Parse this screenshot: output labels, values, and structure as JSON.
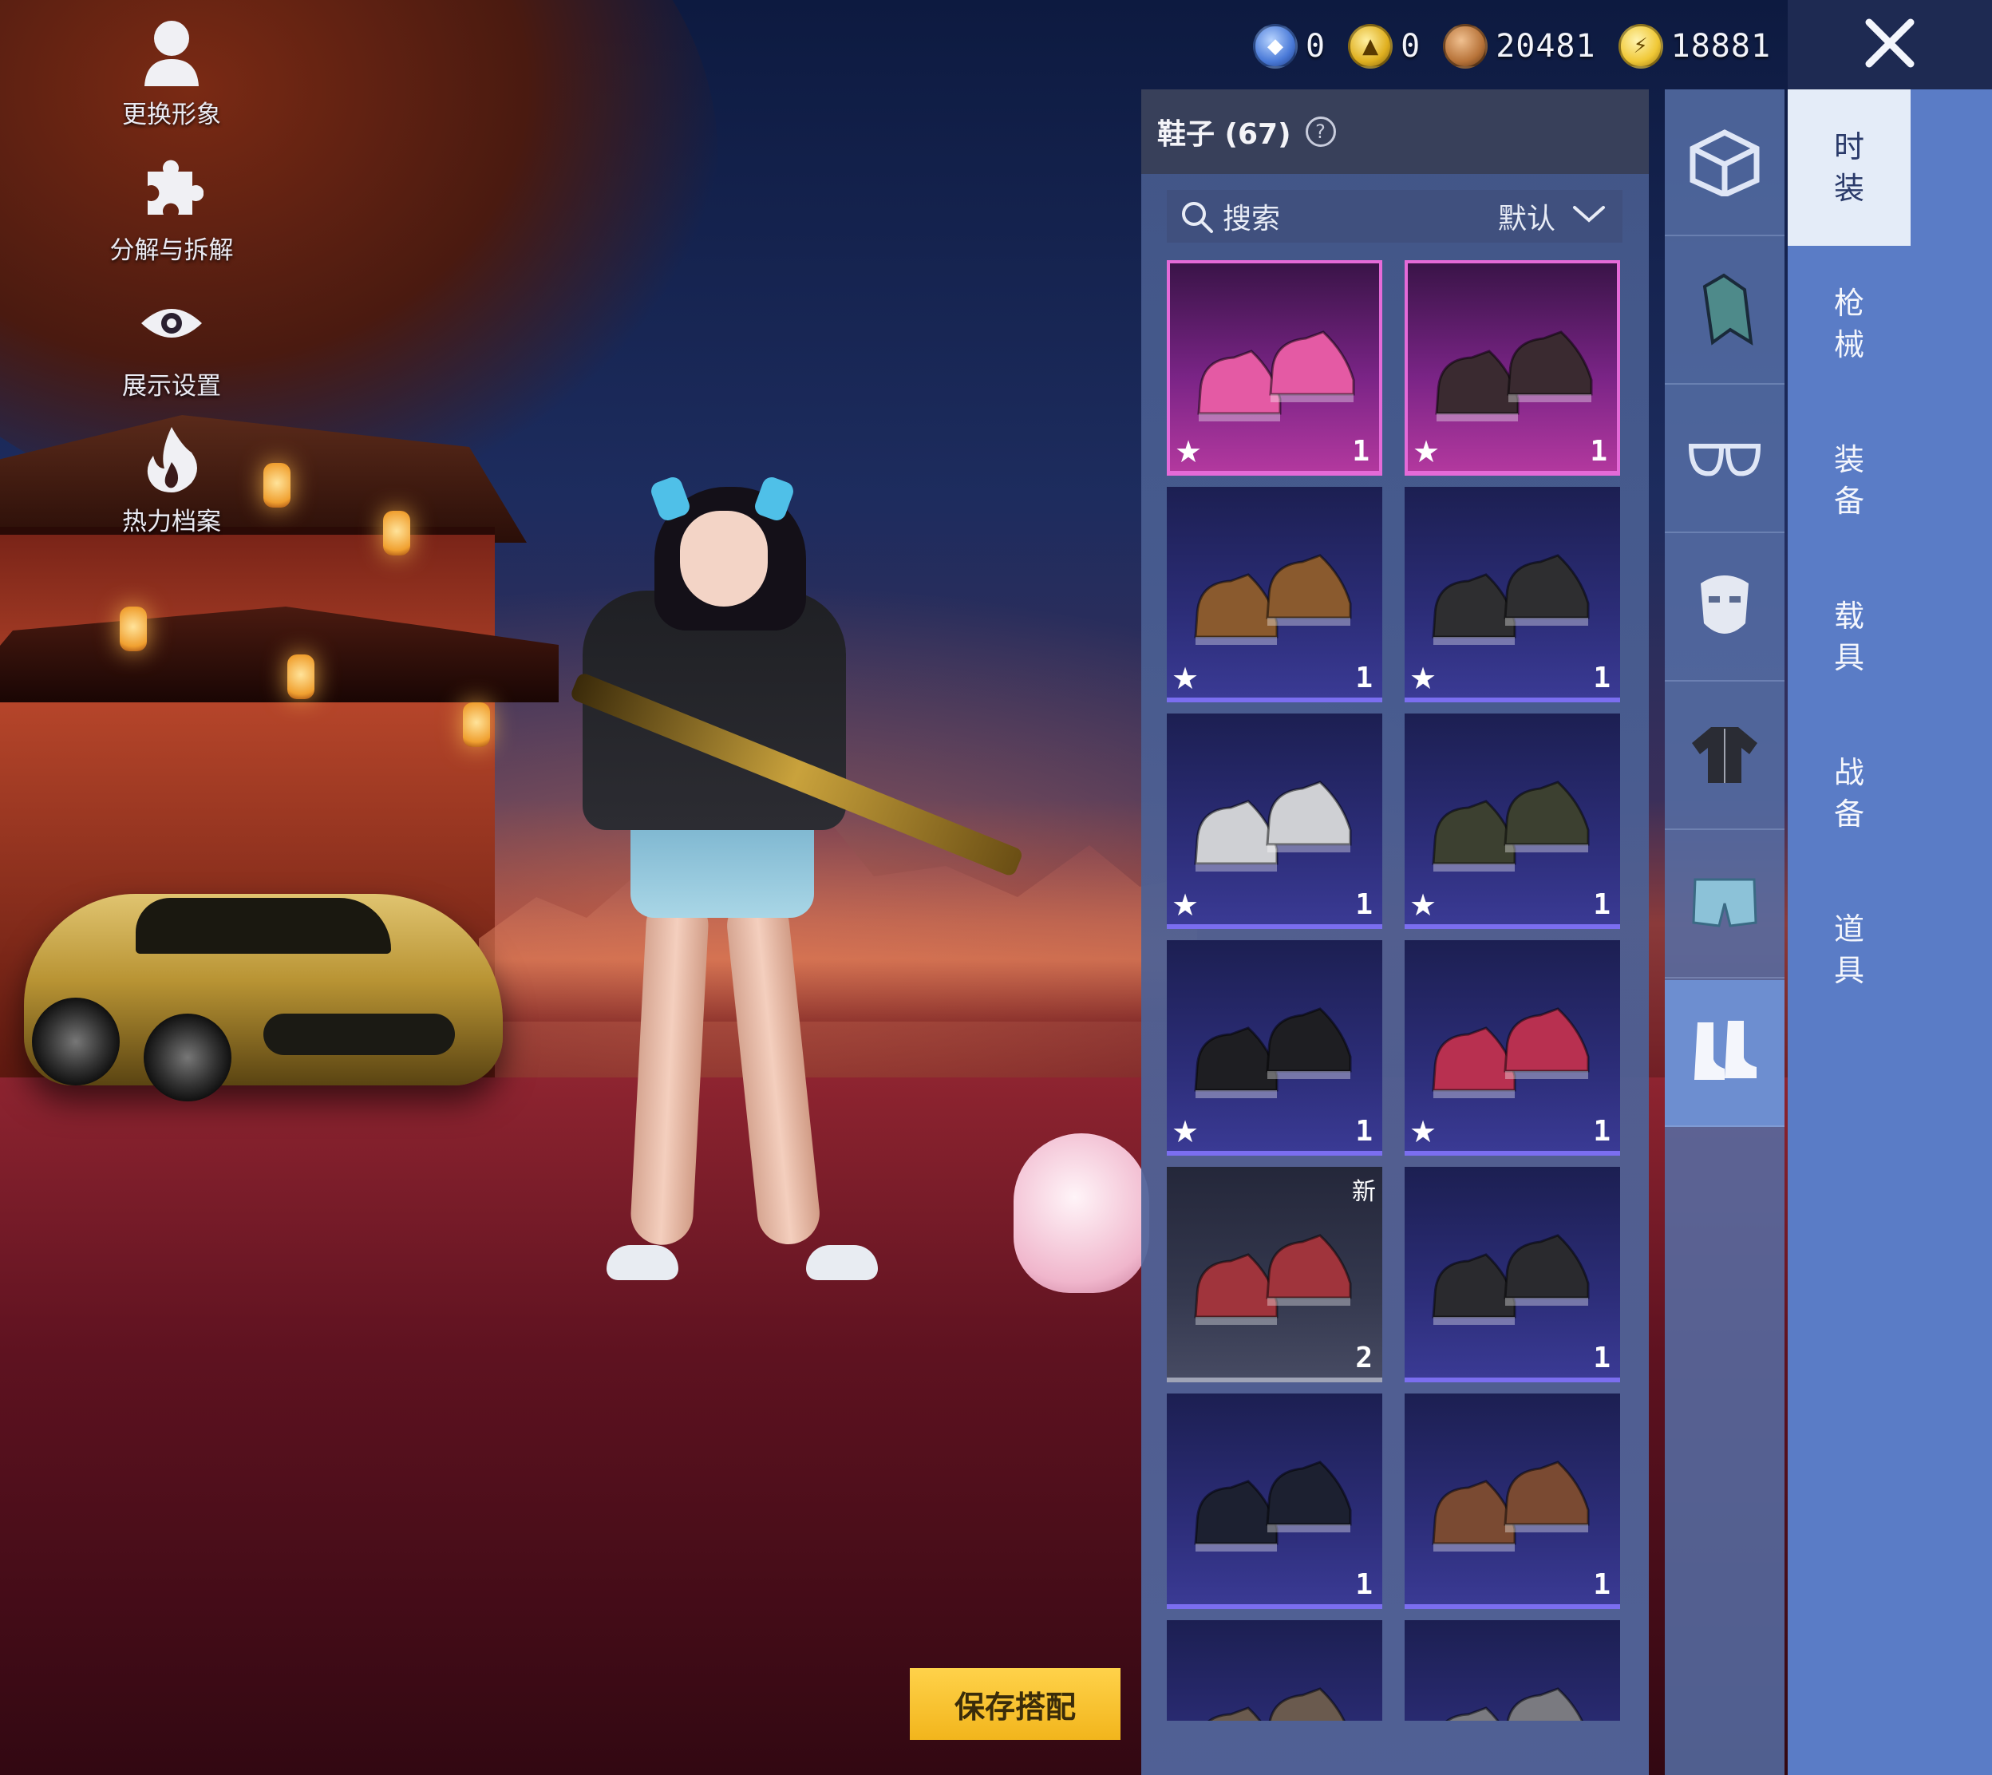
{
  "side_menu": [
    {
      "label": "更换形象",
      "icon": "avatar-icon"
    },
    {
      "label": "分解与拆解",
      "icon": "puzzle-icon"
    },
    {
      "label": "展示设置",
      "icon": "eye-icon"
    },
    {
      "label": "热力档案",
      "icon": "flame-icon"
    }
  ],
  "currencies": [
    {
      "icon": "blue-token-icon",
      "value": "0",
      "color": "#4a7ad8"
    },
    {
      "icon": "gold-token-icon",
      "value": "0",
      "color": "#e0b020"
    },
    {
      "icon": "bronze-coin-icon",
      "value": "20481",
      "color": "#b8743a"
    },
    {
      "icon": "gold-coin-icon",
      "value": "18881",
      "color": "#f0c836"
    }
  ],
  "panel": {
    "title": "鞋子 (67)",
    "help_icon": "?",
    "search_label": "搜索",
    "sort_label": "默认"
  },
  "items": [
    {
      "count": "1",
      "starred": true,
      "rarity": "pink",
      "badge": "",
      "shoe_color": "#e45aa4"
    },
    {
      "count": "1",
      "starred": true,
      "rarity": "pink",
      "badge": "",
      "shoe_color": "#3a2a30"
    },
    {
      "count": "1",
      "starred": true,
      "rarity": "purple",
      "badge": "",
      "shoe_color": "#8a5a2e"
    },
    {
      "count": "1",
      "starred": true,
      "rarity": "purple",
      "badge": "",
      "shoe_color": "#2e2e30"
    },
    {
      "count": "1",
      "starred": true,
      "rarity": "purple",
      "badge": "",
      "shoe_color": "#cfd0d4"
    },
    {
      "count": "1",
      "starred": true,
      "rarity": "purple",
      "badge": "",
      "shoe_color": "#3c4030"
    },
    {
      "count": "1",
      "starred": true,
      "rarity": "purple",
      "badge": "",
      "shoe_color": "#1e1e22"
    },
    {
      "count": "1",
      "starred": true,
      "rarity": "purple",
      "badge": "",
      "shoe_color": "#b83050"
    },
    {
      "count": "2",
      "starred": false,
      "rarity": "grey",
      "badge": "新",
      "shoe_color": "#a0343c"
    },
    {
      "count": "1",
      "starred": false,
      "rarity": "purple",
      "badge": "",
      "shoe_color": "#2a2a2e"
    },
    {
      "count": "1",
      "starred": false,
      "rarity": "purple",
      "badge": "",
      "shoe_color": "#1c2030"
    },
    {
      "count": "1",
      "starred": false,
      "rarity": "purple",
      "badge": "",
      "shoe_color": "#7a4a32"
    },
    {
      "count": "",
      "starred": false,
      "rarity": "purple",
      "badge": "",
      "shoe_color": "#6a5a4e"
    },
    {
      "count": "",
      "starred": false,
      "rarity": "purple",
      "badge": "",
      "shoe_color": "#7a7a80"
    }
  ],
  "save_button": "保存搭配",
  "categories": [
    {
      "icon": "box-icon"
    },
    {
      "icon": "backpack-icon"
    },
    {
      "icon": "glasses-icon"
    },
    {
      "icon": "mask-icon"
    },
    {
      "icon": "jacket-icon"
    },
    {
      "icon": "shorts-icon"
    },
    {
      "icon": "shoes-icon",
      "active": true
    }
  ],
  "tabs": [
    {
      "label": "时装",
      "active": true
    },
    {
      "label": "枪械"
    },
    {
      "label": "装备"
    },
    {
      "label": "载具"
    },
    {
      "label": "战备"
    },
    {
      "label": "道具"
    }
  ],
  "close_icon": "close-icon"
}
